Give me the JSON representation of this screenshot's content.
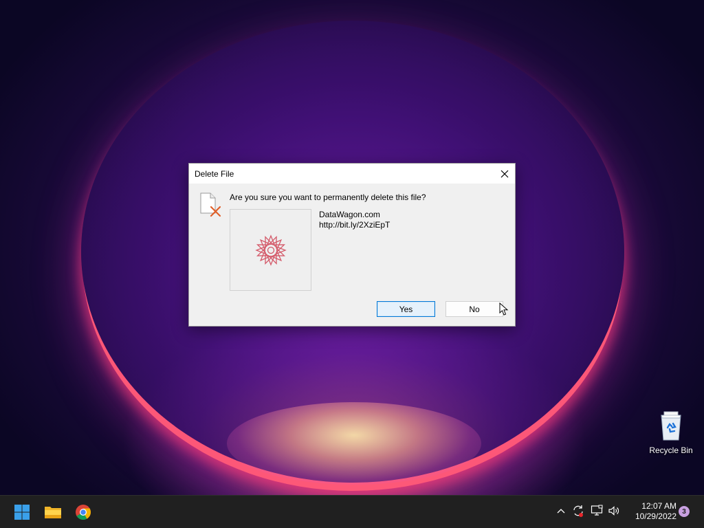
{
  "dialog": {
    "title": "Delete File",
    "question": "Are you sure you want to permanently delete this file?",
    "file_name": "DataWagon.com",
    "file_url": "http://bit.ly/2XziEpT",
    "yes_label": "Yes",
    "no_label": "No",
    "close_icon": "close-icon",
    "file_icon": "file-delete-icon"
  },
  "desktop": {
    "recycle_bin_label": "Recycle Bin"
  },
  "taskbar": {
    "pinned": [
      "start-icon",
      "file-explorer-icon",
      "chrome-icon"
    ],
    "time": "12:07 AM",
    "date": "10/29/2022",
    "notification_count": "3"
  },
  "colors": {
    "accent": "#0078d7",
    "taskbar_bg": "#202020",
    "dialog_bg": "#f0f0f0"
  }
}
